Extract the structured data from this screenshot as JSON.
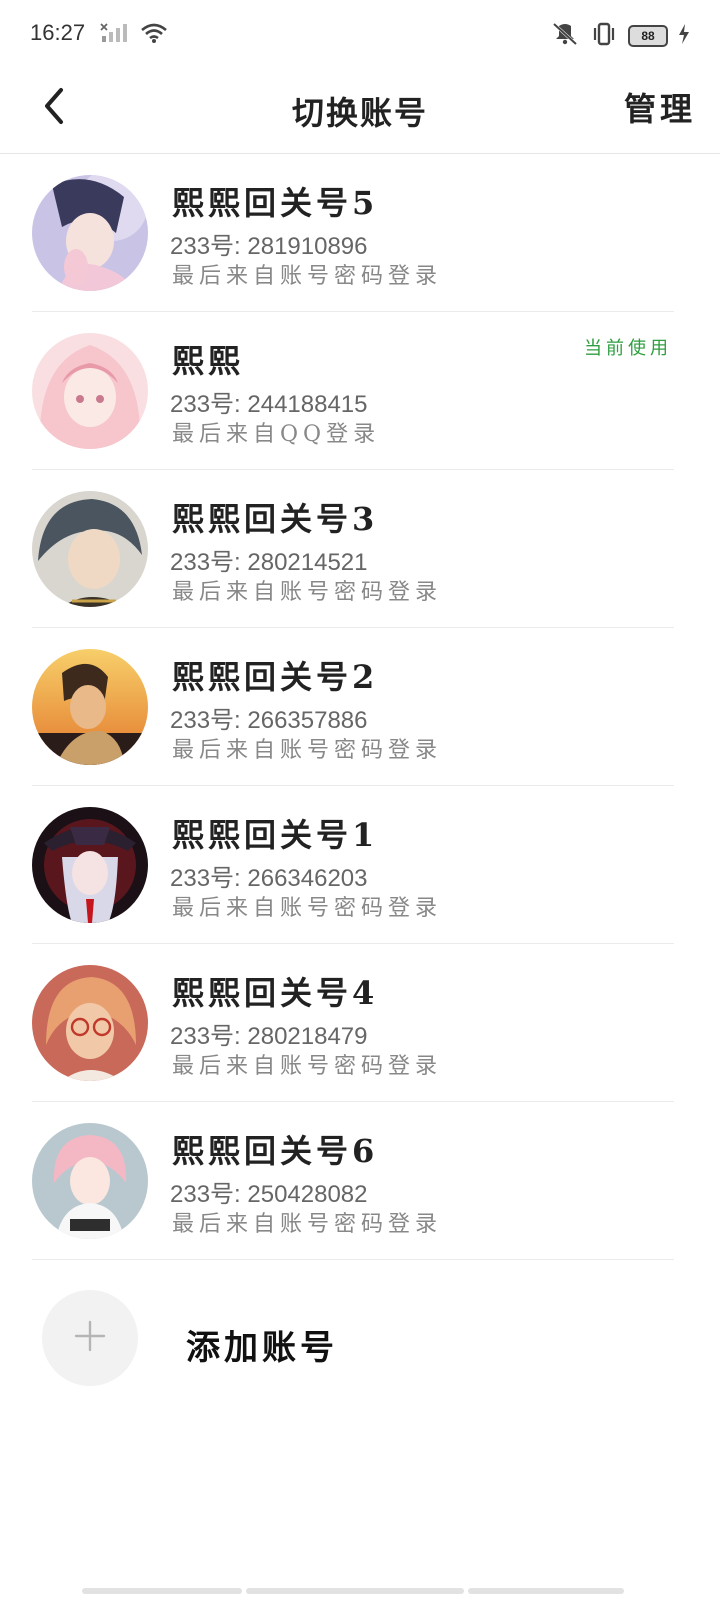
{
  "status_bar": {
    "time": "16:27",
    "battery": "88",
    "icons": [
      "signal-off-icon",
      "wifi-icon",
      "mute-icon",
      "vibrate-icon",
      "battery-icon",
      "charging-icon"
    ]
  },
  "header": {
    "title": "切换账号",
    "manage_label": "管理",
    "back_icon": "back-arrow-icon"
  },
  "accounts": [
    {
      "name": "熙熙回关号5",
      "id": "233号: 281910896",
      "login": "最后来自账号密码登录",
      "current": false,
      "avatar_colors": [
        "#c9c3e6",
        "#f2c8d8",
        "#3a3b5c"
      ]
    },
    {
      "name": "熙熙",
      "id": "233号: 244188415",
      "login": "最后来自QQ登录",
      "current": true,
      "avatar_colors": [
        "#f6c6cc",
        "#f9dfe2",
        "#e89aa8"
      ]
    },
    {
      "name": "熙熙回关号3",
      "id": "233号: 280214521",
      "login": "最后来自账号密码登录",
      "current": false,
      "avatar_colors": [
        "#d9d6cf",
        "#4a5560",
        "#f0d9c4"
      ]
    },
    {
      "name": "熙熙回关号2",
      "id": "233号: 266357886",
      "login": "最后来自账号密码登录",
      "current": false,
      "avatar_colors": [
        "#f2b24a",
        "#3d2a1c",
        "#c9a06a"
      ]
    },
    {
      "name": "熙熙回关号1",
      "id": "233号: 266346203",
      "login": "最后来自账号密码登录",
      "current": false,
      "avatar_colors": [
        "#1a1016",
        "#8e1b24",
        "#d8d8e8"
      ]
    },
    {
      "name": "熙熙回关号4",
      "id": "233号: 280218479",
      "login": "最后来自账号密码登录",
      "current": false,
      "avatar_colors": [
        "#c9695a",
        "#f2c9a8",
        "#e8a070"
      ]
    },
    {
      "name": "熙熙回关号6",
      "id": "233号: 250428082",
      "login": "最后来自账号密码登录",
      "current": false,
      "avatar_colors": [
        "#b9c8cf",
        "#f3b8c4",
        "#f7f7f7"
      ]
    }
  ],
  "current_badge": "当前使用",
  "add_account": {
    "label": "添加账号",
    "icon": "plus-icon"
  },
  "colors": {
    "accent_green": "#2e9e3f",
    "divider": "#ebebeb"
  }
}
